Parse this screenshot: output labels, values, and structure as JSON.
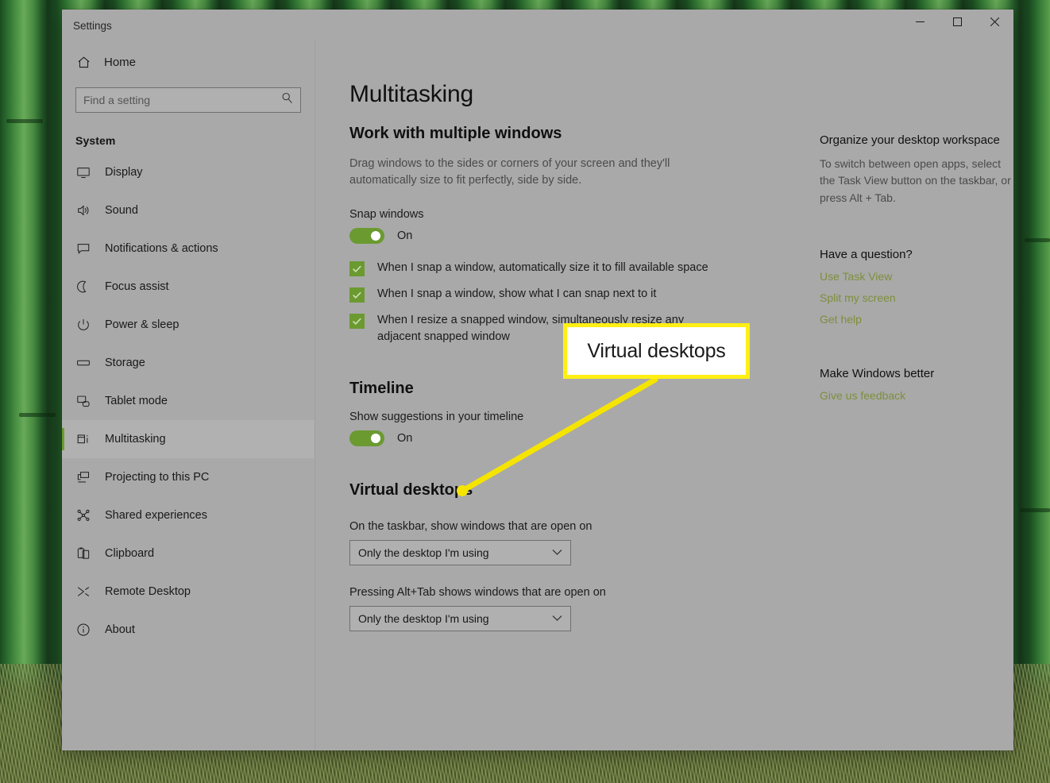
{
  "window": {
    "title": "Settings",
    "controls": {
      "minimize": "Minimize",
      "maximize": "Maximize",
      "close": "Close"
    }
  },
  "sidebar": {
    "home_label": "Home",
    "search_placeholder": "Find a setting",
    "search_value": "",
    "section_title": "System",
    "items": [
      {
        "label": "Display",
        "icon": "monitor-icon",
        "selected": false
      },
      {
        "label": "Sound",
        "icon": "speaker-icon",
        "selected": false
      },
      {
        "label": "Notifications & actions",
        "icon": "chat-icon",
        "selected": false
      },
      {
        "label": "Focus assist",
        "icon": "moon-icon",
        "selected": false
      },
      {
        "label": "Power & sleep",
        "icon": "power-icon",
        "selected": false
      },
      {
        "label": "Storage",
        "icon": "drive-icon",
        "selected": false
      },
      {
        "label": "Tablet mode",
        "icon": "tablet-icon",
        "selected": false
      },
      {
        "label": "Multitasking",
        "icon": "multitask-icon",
        "selected": true
      },
      {
        "label": "Projecting to this PC",
        "icon": "project-icon",
        "selected": false
      },
      {
        "label": "Shared experiences",
        "icon": "share-icon",
        "selected": false
      },
      {
        "label": "Clipboard",
        "icon": "clipboard-icon",
        "selected": false
      },
      {
        "label": "Remote Desktop",
        "icon": "remote-icon",
        "selected": false
      },
      {
        "label": "About",
        "icon": "info-icon",
        "selected": false
      }
    ]
  },
  "main": {
    "page_title": "Multitasking",
    "work_section": {
      "heading": "Work with multiple windows",
      "description": "Drag windows to the sides or corners of your screen and they'll automatically size to fit perfectly, side by side.",
      "snap_label": "Snap windows",
      "snap_state": "On",
      "checkboxes": [
        {
          "label": "When I snap a window, automatically size it to fill available space",
          "checked": true
        },
        {
          "label": "When I snap a window, show what I can snap next to it",
          "checked": true
        },
        {
          "label": "When I resize a snapped window, simultaneously resize any adjacent snapped window",
          "checked": true
        }
      ]
    },
    "timeline_section": {
      "heading": "Timeline",
      "suggestions_label": "Show suggestions in your timeline",
      "suggestions_state": "On"
    },
    "virtual_section": {
      "heading": "Virtual desktops",
      "taskbar_label": "On the taskbar, show windows that are open on",
      "taskbar_value": "Only the desktop I'm using",
      "alttab_label": "Pressing Alt+Tab shows windows that are open on",
      "alttab_value": "Only the desktop I'm using"
    }
  },
  "help": {
    "organize_heading": "Organize your desktop workspace",
    "organize_body": "To switch between open apps, select the Task View button on the taskbar, or press Alt + Tab.",
    "question_heading": "Have a question?",
    "question_links": [
      "Use Task View",
      "Split my screen",
      "Get help"
    ],
    "better_heading": "Make Windows better",
    "better_links": [
      "Give us feedback"
    ]
  },
  "annotation": {
    "callout_text": "Virtual desktops",
    "box_color": "#ffef14",
    "box_fill": "#ffffff",
    "line_color": "#f5e400"
  },
  "colors": {
    "window_bg": "#a9a9a9",
    "accent_green": "#6b9a31",
    "link_green": "#7e8e3c",
    "selection_bar": "#6f9a2e"
  }
}
